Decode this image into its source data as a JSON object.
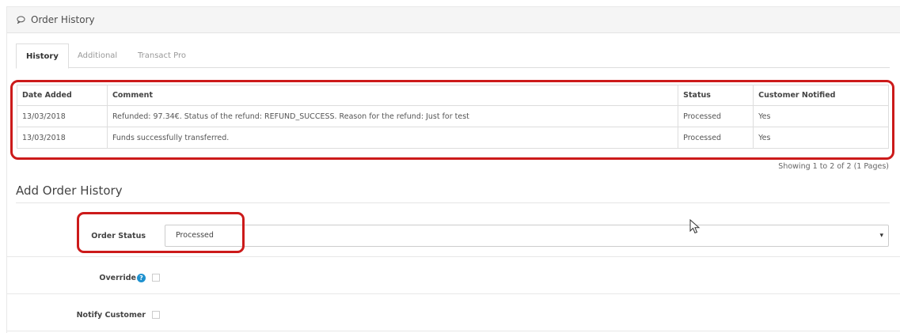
{
  "panel": {
    "title": "Order History",
    "icon": "chat-bubble-icon"
  },
  "tabs": [
    {
      "label": "History",
      "active": true
    },
    {
      "label": "Additional",
      "active": false
    },
    {
      "label": "Transact Pro",
      "active": false
    }
  ],
  "history_table": {
    "headers": [
      "Date Added",
      "Comment",
      "Status",
      "Customer Notified"
    ],
    "rows": [
      {
        "date": "13/03/2018",
        "comment": "Refunded: 97.34€. Status of the refund: REFUND_SUCCESS. Reason for the refund: Just for test",
        "status": "Processed",
        "notified": "Yes"
      },
      {
        "date": "13/03/2018",
        "comment": "Funds successfully transferred.",
        "status": "Processed",
        "notified": "Yes"
      }
    ],
    "pagination": "Showing 1 to 2 of 2 (1 Pages)"
  },
  "add_history": {
    "title": "Add Order History",
    "order_status_label": "Order Status",
    "order_status_value": "Processed",
    "override_label": "Override",
    "override_help": "?",
    "override_checked": false,
    "notify_label": "Notify Customer",
    "notify_checked": false
  },
  "colors": {
    "highlight": "#cc1a1a",
    "help_icon": "#1e91cf"
  }
}
